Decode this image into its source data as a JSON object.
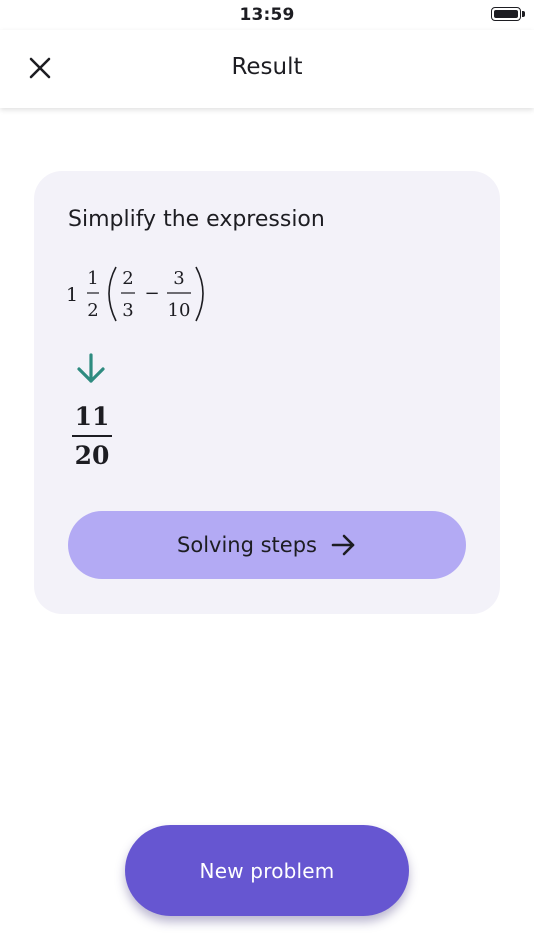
{
  "status_bar": {
    "time": "13:59",
    "battery_icon": "battery-full-icon"
  },
  "header": {
    "title": "Result",
    "close_icon": "close-icon"
  },
  "problem": {
    "label": "Simplify the expression",
    "expression": {
      "whole": "1",
      "mixed_num": "1",
      "mixed_den": "2",
      "frac1_num": "2",
      "frac1_den": "3",
      "operator": "−",
      "frac2_num": "3",
      "frac2_den": "10"
    },
    "arrow_icon": "arrow-down-icon",
    "result": {
      "numerator": "11",
      "denominator": "20"
    }
  },
  "steps_button": {
    "label": "Solving steps",
    "icon": "arrow-right-icon"
  },
  "new_problem_button": {
    "label": "New problem"
  },
  "colors": {
    "card_background": "#f3f2f9",
    "steps_button": "#b3aaf4",
    "primary_button": "#6656d1",
    "arrow_accent": "#2e8b80"
  }
}
